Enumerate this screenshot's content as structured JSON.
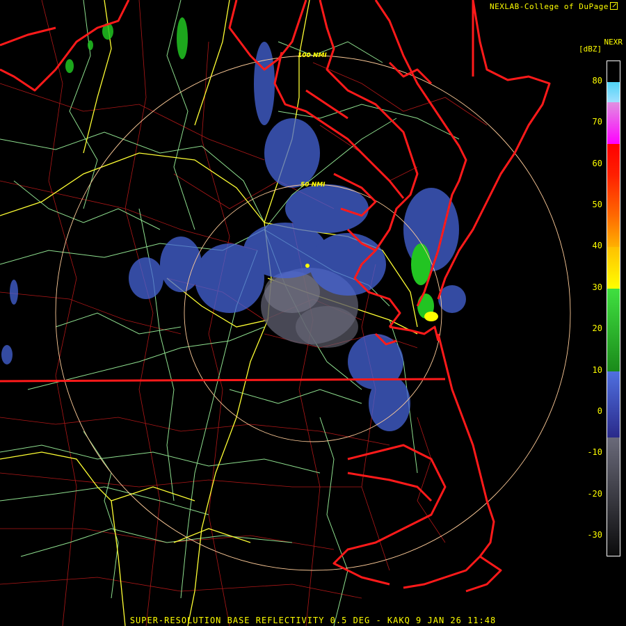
{
  "header": {
    "credit": "NEXLAB-College of DuPage",
    "product_code": "NEXR",
    "units": "[dBZ]"
  },
  "range_rings": {
    "inner_label": "50 NMI",
    "outer_label": "100 NMI"
  },
  "legend": {
    "ticks": [
      "80",
      "70",
      "60",
      "50",
      "40",
      "30",
      "20",
      "10",
      "0",
      "-10",
      "-20",
      "-30"
    ],
    "colors": {
      "extreme": "#4fd3f5",
      "very_high": "#ff00ff",
      "high": "#ff0000",
      "moderate": "#ff8c00",
      "light": "#ffff00",
      "green": "#22c422",
      "blue": "#4664d8",
      "grey": "#5a5a6a"
    }
  },
  "footer": {
    "title": "SUPER-RESOLUTION BASE REFLECTIVITY 0.5 DEG - KAKQ 9 JAN 26 11:48"
  },
  "map_colors": {
    "state_borders": "#ff1a1a",
    "county_lines": "#b01818",
    "highways": "#ffff33",
    "secondary_roads": "#8fe08f",
    "range_rings": "#ffcc99"
  }
}
